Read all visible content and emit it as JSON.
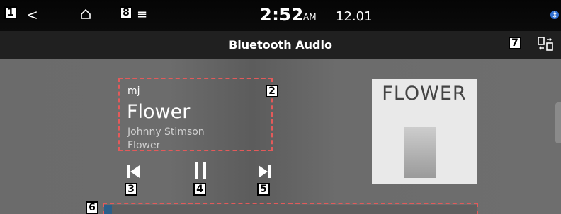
{
  "callouts": {
    "back": "1",
    "menu": "8",
    "info": "2",
    "prev": "3",
    "play": "4",
    "next": "5",
    "progress": "6",
    "source": "7"
  },
  "status_bar": {
    "back_glyph": "<",
    "home_icon": "home-icon",
    "menu_glyph": "≡",
    "time": "2:52",
    "ampm": "AM",
    "date": "12.01",
    "bluetooth_icon": "bluetooth-icon"
  },
  "title_bar": {
    "title": "Bluetooth Audio",
    "source_icon": "switch-source-icon"
  },
  "track": {
    "artist_short": "mj",
    "title": "Flower",
    "artist": "Johnny Stimson",
    "album": "Flower"
  },
  "album_art": {
    "text": "FLOWER"
  },
  "controls": {
    "prev_icon": "skip-previous-icon",
    "play_icon": "pause-icon",
    "next_icon": "skip-next-icon"
  },
  "progress": {
    "fraction": 0.02
  },
  "colors": {
    "accent": "#2b5f8a",
    "callout_border": "#e35a5a",
    "status_bg": "#050505",
    "title_bg": "#202020"
  }
}
